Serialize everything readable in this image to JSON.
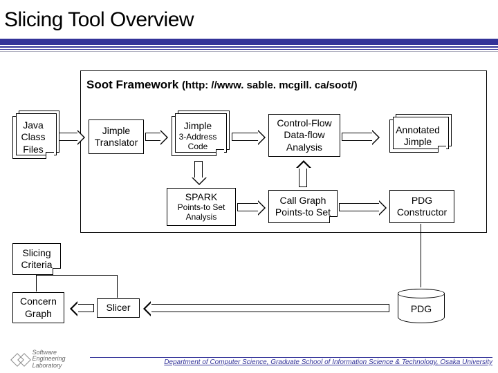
{
  "title": "Slicing Tool Overview",
  "soot_frame": {
    "label": "Soot Framework",
    "url": "(http: //www. sable. mcgill. ca/soot/)"
  },
  "nodes": {
    "java": {
      "l1": "Java",
      "l2": "Class",
      "l3": "Files"
    },
    "translator": {
      "l1": "Jimple",
      "l2": "Translator"
    },
    "jimple3": {
      "title": "Jimple",
      "sub1": "3-Address",
      "sub2": "Code"
    },
    "cfda": {
      "l1": "Control-Flow",
      "l2": "Data-flow",
      "l3": "Analysis"
    },
    "annotated": {
      "l1": "Annotated",
      "l2": "Jimple"
    },
    "spark": {
      "title": "SPARK",
      "sub1": "Points-to Set",
      "sub2": "Analysis"
    },
    "callgraph": {
      "l1": "Call Graph",
      "l2": "Points-to Set"
    },
    "pdgc": {
      "l1": "PDG",
      "l2": "Constructor"
    },
    "criteria": {
      "l1": "Slicing",
      "l2": "Criteria"
    },
    "concern": {
      "l1": "Concern",
      "l2": "Graph"
    },
    "slicer": "Slicer",
    "pdg": "PDG"
  },
  "logo": {
    "l1": "Software",
    "l2": "Engineering",
    "l3": "Laboratory"
  },
  "footer": "Department of Computer Science, Graduate School of Information Science & Technology, Osaka University"
}
